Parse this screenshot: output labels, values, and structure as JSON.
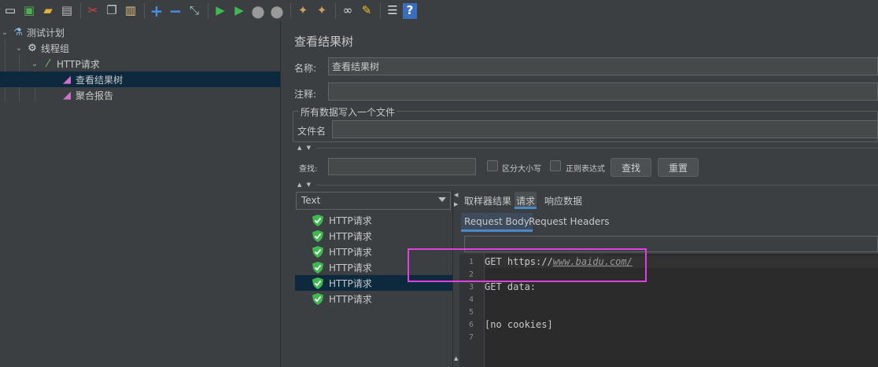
{
  "toolbar": {
    "buttons": [
      {
        "name": "new-icon",
        "glyph": "📄"
      },
      {
        "name": "templates-icon",
        "glyph": "📗"
      },
      {
        "name": "open-icon",
        "glyph": "📂"
      },
      {
        "name": "save-icon",
        "glyph": "💾"
      },
      {
        "name": "cut-icon",
        "glyph": "✂"
      },
      {
        "name": "copy-icon",
        "glyph": "❐"
      },
      {
        "name": "paste-icon",
        "glyph": "📋"
      },
      {
        "name": "expand-icon",
        "glyph": "+"
      },
      {
        "name": "collapse-icon",
        "glyph": "−"
      },
      {
        "name": "toggle-icon",
        "glyph": "⤢"
      },
      {
        "name": "start-icon",
        "glyph": "▶"
      },
      {
        "name": "start-no-pauses-icon",
        "glyph": "▶"
      },
      {
        "name": "stop-icon",
        "glyph": "⬤"
      },
      {
        "name": "shutdown-icon",
        "glyph": "⬤"
      },
      {
        "name": "clear-icon",
        "glyph": "🧹"
      },
      {
        "name": "clear-all-icon",
        "glyph": "🧹"
      },
      {
        "name": "search-icon",
        "glyph": "🔭"
      },
      {
        "name": "reset-search-icon",
        "glyph": "🧽"
      },
      {
        "name": "function-helper-icon",
        "glyph": "☰"
      },
      {
        "name": "help-icon",
        "glyph": "?"
      }
    ]
  },
  "tree": {
    "items": [
      {
        "label": "测试计划"
      },
      {
        "label": "线程组"
      },
      {
        "label": "HTTP请求"
      },
      {
        "label": "查看结果树"
      },
      {
        "label": "聚合报告"
      }
    ]
  },
  "panel": {
    "title": "查看结果树",
    "name_label": "名称:",
    "name_value": "查看结果树",
    "comment_label": "注释:",
    "comment_value": "",
    "file_group_title": "所有数据写入一个文件",
    "filename_label": "文件名",
    "filename_value": "",
    "search_label": "查找:",
    "search_value": "",
    "case_sensitive_label": "区分大小写",
    "regex_label": "正则表达式",
    "find_button": "查找",
    "reset_button": "重置"
  },
  "results": {
    "renderer": "Text",
    "samples": [
      "HTTP请求",
      "HTTP请求",
      "HTTP请求",
      "HTTP请求",
      "HTTP请求",
      "HTTP请求"
    ],
    "selected_index": 4
  },
  "tabs": {
    "items": [
      "取样器结果",
      "请求",
      "响应数据"
    ],
    "active": 1,
    "subtabs": [
      "Request Body",
      "Request Headers"
    ],
    "active_subtab": 0
  },
  "editor": {
    "lines": [
      {
        "n": "1",
        "prefix": "GET https://",
        "link": "www.baidu.com/"
      },
      {
        "n": "2",
        "prefix": "",
        "link": ""
      },
      {
        "n": "3",
        "prefix": "GET data:",
        "link": ""
      },
      {
        "n": "4",
        "prefix": "",
        "link": ""
      },
      {
        "n": "5",
        "prefix": "",
        "link": ""
      },
      {
        "n": "6",
        "prefix": "[no cookies]",
        "link": ""
      },
      {
        "n": "7",
        "prefix": "",
        "link": ""
      }
    ]
  },
  "colors": {
    "background": "#3c3f41",
    "selection": "#0d293e",
    "accent": "#4a88c7",
    "highlight": "#e040e0",
    "success": "#3fb950"
  }
}
